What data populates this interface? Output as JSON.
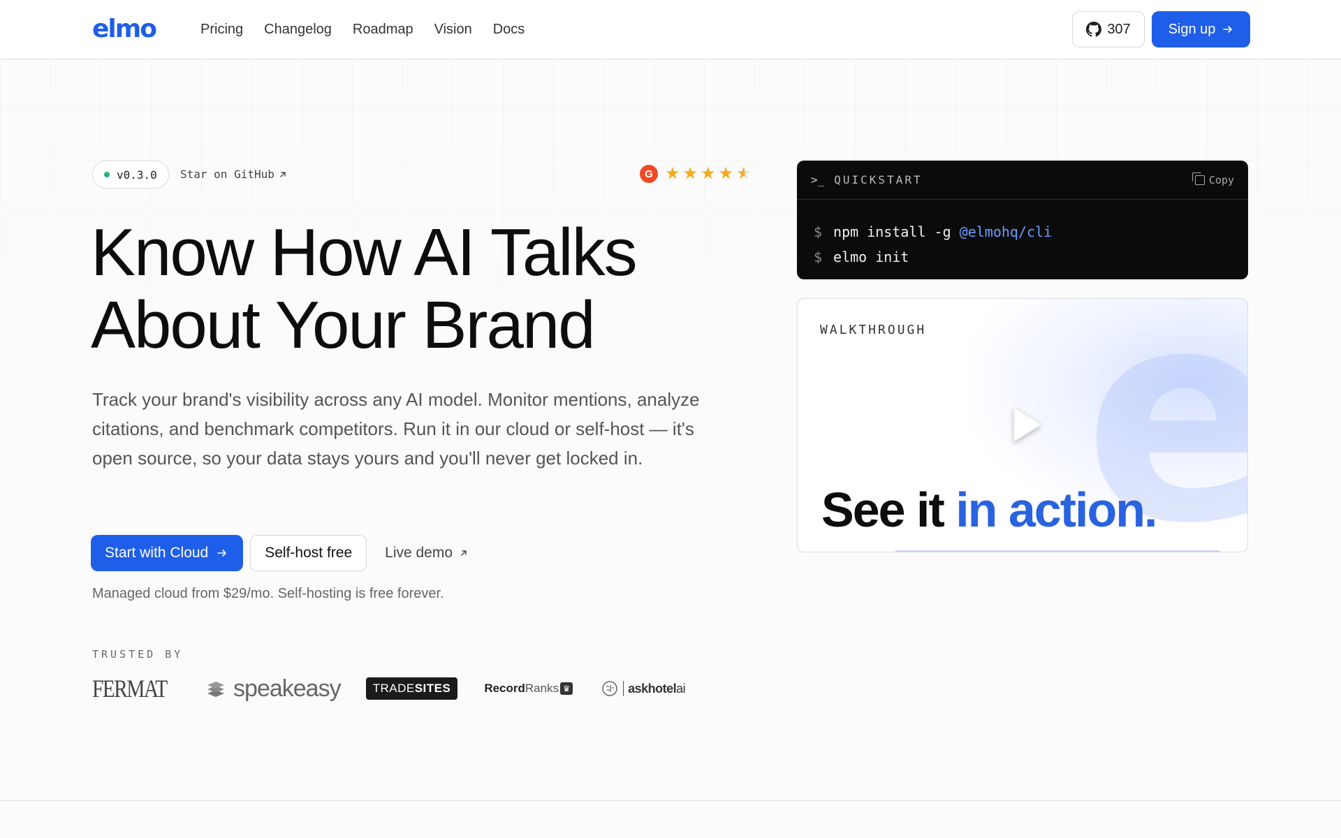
{
  "header": {
    "logo": "elmo",
    "nav": [
      "Pricing",
      "Changelog",
      "Roadmap",
      "Vision",
      "Docs"
    ],
    "github_stars": "307",
    "signup_label": "Sign up"
  },
  "hero": {
    "version": "v0.3.0",
    "star_on_github": "Star on GitHub",
    "rating_stars": 4.5,
    "title_line1": "Know How AI Talks",
    "title_line2": "About Your Brand",
    "description": "Track your brand's visibility across any AI model. Monitor mentions, analyze citations, and benchmark competitors. Run it in our cloud or self-host — it's open source, so your data stays yours and you'll never get locked in.",
    "cta_primary": "Start with Cloud",
    "cta_secondary": "Self-host free",
    "cta_link": "Live demo",
    "managed_note": "Managed cloud from $29/mo. Self-hosting is free forever."
  },
  "trusted": {
    "label": "TRUSTED BY",
    "logos": {
      "fermat": "FERMAT",
      "speakeasy": "speakeasy",
      "tradesites_a": "TRADE",
      "tradesites_b": "SITES",
      "recordranks_a": "Record",
      "recordranks_b": "Ranks",
      "askhotel_a": "ask",
      "askhotel_b": "hotel",
      "askhotel_c": "ai"
    }
  },
  "quickstart": {
    "title": "QUICKSTART",
    "copy_label": "Copy",
    "line1_cmd": "npm install -g ",
    "line1_pkg": "@elmohq/cli",
    "line2_cmd": "elmo init",
    "prompt_symbol": "$"
  },
  "walkthrough": {
    "label": "WALKTHROUGH",
    "cta_black": "See it ",
    "cta_blue": "in action."
  },
  "icons": {
    "github": "github-icon",
    "arrow_right": "arrow-right-icon",
    "arrow_up_right": "arrow-up-right-icon",
    "copy": "copy-icon",
    "play": "play-icon",
    "terminal": "terminal-prompt-icon",
    "g2": "g2-logo-icon",
    "star": "star-icon"
  },
  "colors": {
    "accent": "#1f5ee8",
    "terminal_bg": "#0b0b0b",
    "status_green": "#22b573",
    "star": "#f6a91c",
    "g2_red": "#ef4a23"
  }
}
